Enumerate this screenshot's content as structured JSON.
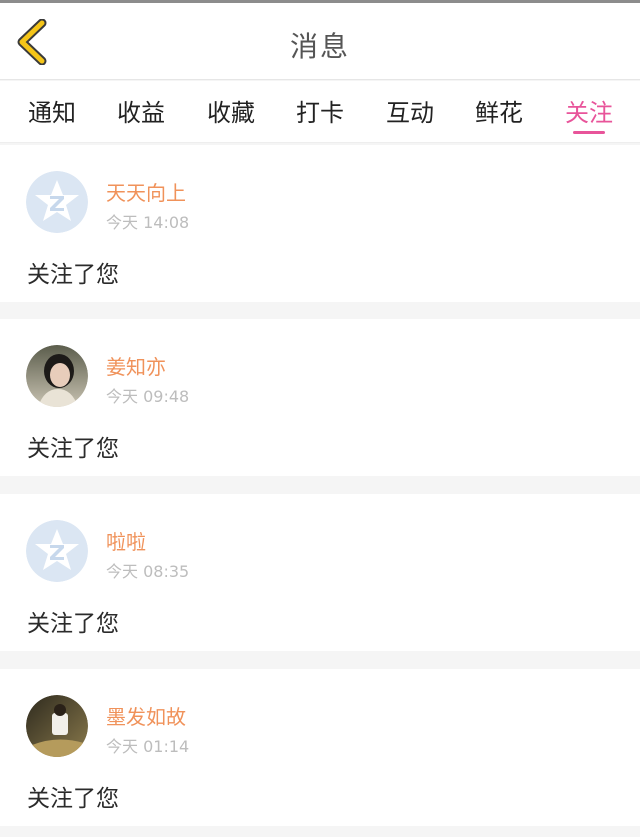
{
  "header": {
    "title": "消息",
    "back_icon": "chevron-left-icon",
    "back_color": "#f5c518"
  },
  "tabs": [
    {
      "label": "通知"
    },
    {
      "label": "收益"
    },
    {
      "label": "收藏"
    },
    {
      "label": "打卡"
    },
    {
      "label": "互动"
    },
    {
      "label": "鲜花"
    },
    {
      "label": "关注",
      "active": true
    }
  ],
  "accent_color": "#e8549a",
  "name_color": "#f0925a",
  "notifications": [
    {
      "name": "天天向上",
      "time": "今天 14:08",
      "message": "关注了您",
      "avatar": "default-avatar-icon"
    },
    {
      "name": "姜知亦",
      "time": "今天 09:48",
      "message": "关注了您",
      "avatar": "user-photo"
    },
    {
      "name": "啦啦",
      "time": "今天 08:35",
      "message": "关注了您",
      "avatar": "default-avatar-icon"
    },
    {
      "name": "墨发如故",
      "time": "今天 01:14",
      "message": "关注了您",
      "avatar": "user-photo"
    }
  ]
}
